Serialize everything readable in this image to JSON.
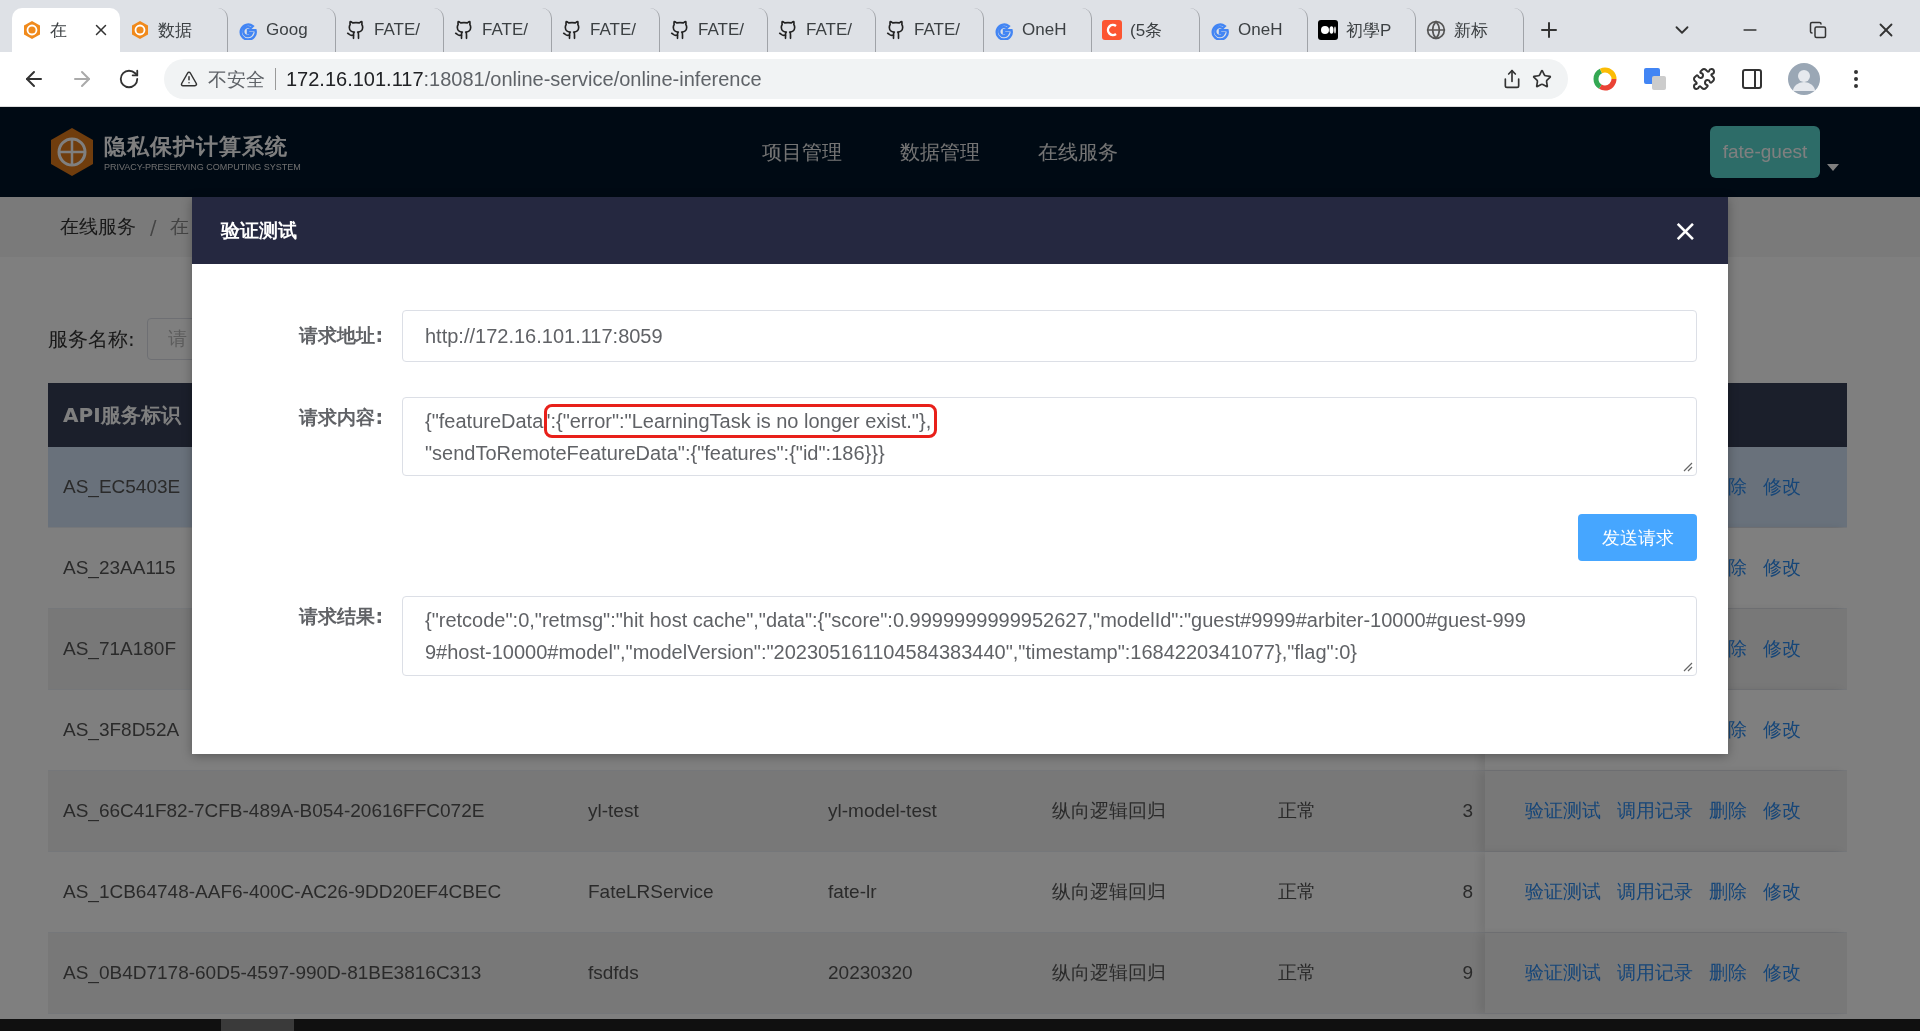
{
  "browser": {
    "tabs": [
      {
        "kind": "fate",
        "title": "在",
        "selected": true
      },
      {
        "kind": "fate",
        "title": "数据",
        "selected": false
      },
      {
        "kind": "google",
        "title": "Goog",
        "selected": false
      },
      {
        "kind": "github",
        "title": "FATE/",
        "selected": false
      },
      {
        "kind": "github",
        "title": "FATE/",
        "selected": false
      },
      {
        "kind": "github",
        "title": "FATE/",
        "selected": false
      },
      {
        "kind": "github",
        "title": "FATE/",
        "selected": false
      },
      {
        "kind": "github",
        "title": "FATE/",
        "selected": false
      },
      {
        "kind": "github",
        "title": "FATE/",
        "selected": false
      },
      {
        "kind": "google",
        "title": "OneH",
        "selected": false
      },
      {
        "kind": "csdn",
        "title": "(5条",
        "selected": false
      },
      {
        "kind": "google",
        "title": "OneH",
        "selected": false
      },
      {
        "kind": "medium",
        "title": "初學P",
        "selected": false
      },
      {
        "kind": "globe",
        "title": "新标",
        "selected": false
      }
    ],
    "address": {
      "security": "不安全",
      "host": "172.16.101.117",
      "path": ":18081/online-service/online-inference"
    }
  },
  "app": {
    "logo": {
      "title": "隐私保护计算系统",
      "subtitle": "PRIVACY-PRESERVING COMPUTING SYSTEM"
    },
    "nav": [
      {
        "label": "项目管理",
        "selected": false
      },
      {
        "label": "数据管理",
        "selected": false
      },
      {
        "label": "在线服务",
        "selected": false
      }
    ],
    "user": "fate-guest"
  },
  "breadcrumb": {
    "items": [
      "在线服务",
      "在"
    ],
    "separator": "/"
  },
  "search": {
    "label": "服务名称:",
    "placeholder": "请"
  },
  "table": {
    "columns": [
      "API服务标识"
    ],
    "rows": [
      {
        "cells": [
          "AS_EC5403E"
        ],
        "actions": [
          "除",
          "修改"
        ],
        "selected": true
      },
      {
        "cells": [
          "AS_23AA115"
        ],
        "actions": [
          "除",
          "修改"
        ],
        "selected": false
      },
      {
        "cells": [
          "AS_71A180F"
        ],
        "actions": [
          "除",
          "修改"
        ],
        "selected": false
      },
      {
        "cells": [
          "AS_3F8D52A"
        ],
        "actions": [
          "除",
          "修改"
        ],
        "selected": false
      },
      {
        "cells": [
          "AS_66C41F82-7CFB-489A-B054-20616FFC072E",
          "yl-test",
          "yl-model-test",
          "纵向逻辑回归",
          "正常",
          "3"
        ],
        "actions": [
          "验证测试",
          "调用记录",
          "删除",
          "修改"
        ],
        "selected": false
      },
      {
        "cells": [
          "AS_1CB64748-AAF6-400C-AC26-9DD20EF4CBEC",
          "FateLRService",
          "fate-lr",
          "纵向逻辑回归",
          "正常",
          "8"
        ],
        "actions": [
          "验证测试",
          "调用记录",
          "删除",
          "修改"
        ],
        "selected": false
      },
      {
        "cells": [
          "AS_0B4D7178-60D5-4597-990D-81BE3816C313",
          "fsdfds",
          "20230320",
          "纵向逻辑回归",
          "正常",
          "9"
        ],
        "actions": [
          "验证测试",
          "调用记录",
          "删除",
          "修改"
        ],
        "selected": false
      }
    ]
  },
  "modal": {
    "title": "验证测试",
    "close": "×",
    "url": {
      "label": "请求地址:",
      "value": "http://172.16.101.117:8059"
    },
    "content": {
      "label": "请求内容:",
      "value_before": "{\"featureData\"",
      "value_marked": ":{\"error\":\"LearningTask is no longer exist.\"},",
      "value_after": "\"sendToRemoteFeatureData\":{\"features\":{\"id\":186}}}"
    },
    "send_button": "发送请求",
    "result": {
      "label": "请求结果:",
      "lines": [
        "{\"retcode\":0,\"retmsg\":\"hit host cache\",\"data\":{\"score\":0.9999999999952627,\"modelId\":\"guest#9999#arbiter-10000#guest-999",
        "9#host-10000#model\",\"modelVersion\":\"202305161104584383440\",\"timestamp\":1684220341077},\"flag\":0}"
      ]
    }
  }
}
